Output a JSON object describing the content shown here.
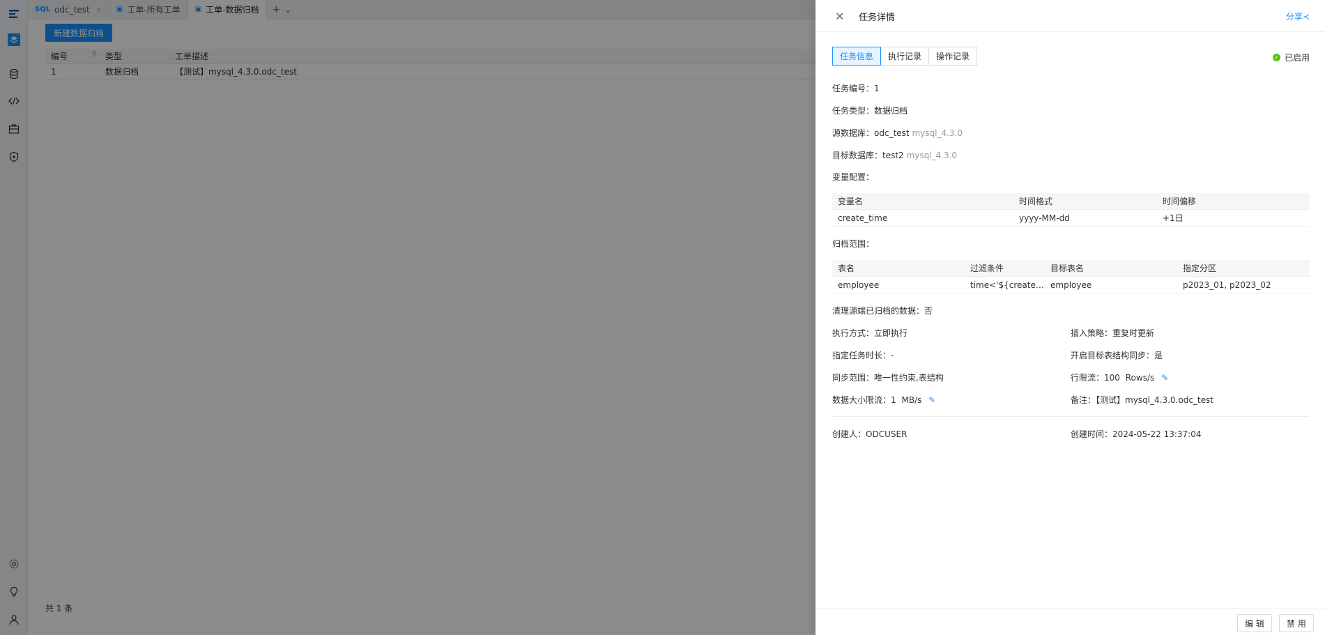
{
  "tabs": [
    {
      "icon": "SQL",
      "label": "odc_test",
      "close": "×"
    },
    {
      "icon": "▣",
      "label": "工单-所有工单"
    },
    {
      "icon": "▣",
      "label": "工单-数据归档"
    }
  ],
  "tab_add": "+",
  "tab_more": "⌄",
  "main": {
    "create_button": "新建数据归档",
    "columns": [
      "编号",
      "类型",
      "工单描述"
    ],
    "rows": [
      {
        "id": "1",
        "type": "数据归档",
        "desc": "【测试】mysql_4.3.0.odc_test"
      }
    ],
    "footer": "共 1 条"
  },
  "drawer": {
    "title": "任务详情",
    "share": "分享",
    "tabs": [
      "任务信息",
      "执行记录",
      "操作记录"
    ],
    "status": "已启用",
    "task_id_label": "任务编号：",
    "task_id": "1",
    "task_type_label": "任务类型：",
    "task_type": "数据归档",
    "source_db_label": "源数据库：",
    "source_db": "odc_test",
    "source_db_ver": "mysql_4.3.0",
    "target_db_label": "目标数据库：",
    "target_db": "test2",
    "target_db_ver": "mysql_4.3.0",
    "var_label": "变量配置：",
    "var_columns": [
      "变量名",
      "时间格式",
      "时间偏移"
    ],
    "var_rows": [
      [
        "create_time",
        "yyyy-MM-dd",
        "+1日"
      ]
    ],
    "range_label": "归档范围：",
    "range_columns": [
      "表名",
      "过滤条件",
      "目标表名",
      "指定分区"
    ],
    "range_rows": [
      [
        "employee",
        "time<'${create_time}'",
        "employee",
        "p2023_01, p2023_02"
      ]
    ],
    "cleanup_label": "清理源端已归档的数据：",
    "cleanup": "否",
    "exec_mode_label": "执行方式：",
    "exec_mode": "立即执行",
    "insert_label": "插入策略：",
    "insert": "重复时更新",
    "duration_label": "指定任务时长：",
    "duration": "-",
    "sync_label": "开启目标表结构同步：",
    "sync": "是",
    "sync_range_label": "同步范围：",
    "sync_range": "唯一性约束,表结构",
    "row_limit_label": "行限流：",
    "row_limit": "100",
    "row_limit_unit": "Rows/s",
    "size_limit_label": "数据大小限流：",
    "size_limit": "1",
    "size_limit_unit": "MB/s",
    "remark_label": "备注：",
    "remark": "【测试】mysql_4.3.0.odc_test",
    "creator_label": "创建人：",
    "creator": "ODCUSER",
    "created_label": "创建时间：",
    "created": "2024-05-22 13:37:04",
    "edit_button": "编 辑",
    "disable_button": "禁 用"
  },
  "colors": {
    "accent": "#1890ff",
    "status_ok": "#52c41a"
  }
}
